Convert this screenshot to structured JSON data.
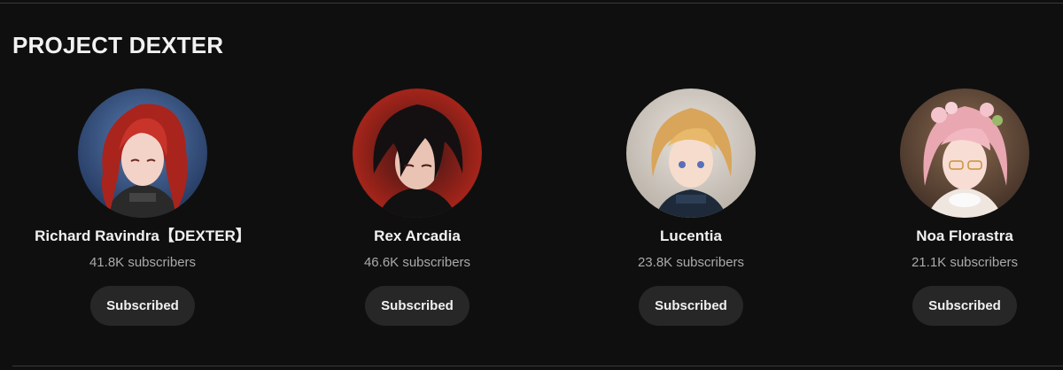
{
  "section": {
    "title": "PROJECT DEXTER"
  },
  "channels": [
    {
      "name": "Richard Ravindra【DEXTER】",
      "subscribers": "41.8K subscribers",
      "button_label": "Subscribed",
      "avatar_icon": "channel-avatar-red-hair"
    },
    {
      "name": "Rex Arcadia",
      "subscribers": "46.6K subscribers",
      "button_label": "Subscribed",
      "avatar_icon": "channel-avatar-dark-hair"
    },
    {
      "name": "Lucentia",
      "subscribers": "23.8K subscribers",
      "button_label": "Subscribed",
      "avatar_icon": "channel-avatar-blonde-hair"
    },
    {
      "name": "Noa Florastra",
      "subscribers": "21.1K subscribers",
      "button_label": "Subscribed",
      "avatar_icon": "channel-avatar-pink-hair"
    }
  ],
  "colors": {
    "background": "#0f0f0f",
    "button_bg": "#272727",
    "text_primary": "#f1f1f1",
    "text_secondary": "#aaaaaa"
  }
}
